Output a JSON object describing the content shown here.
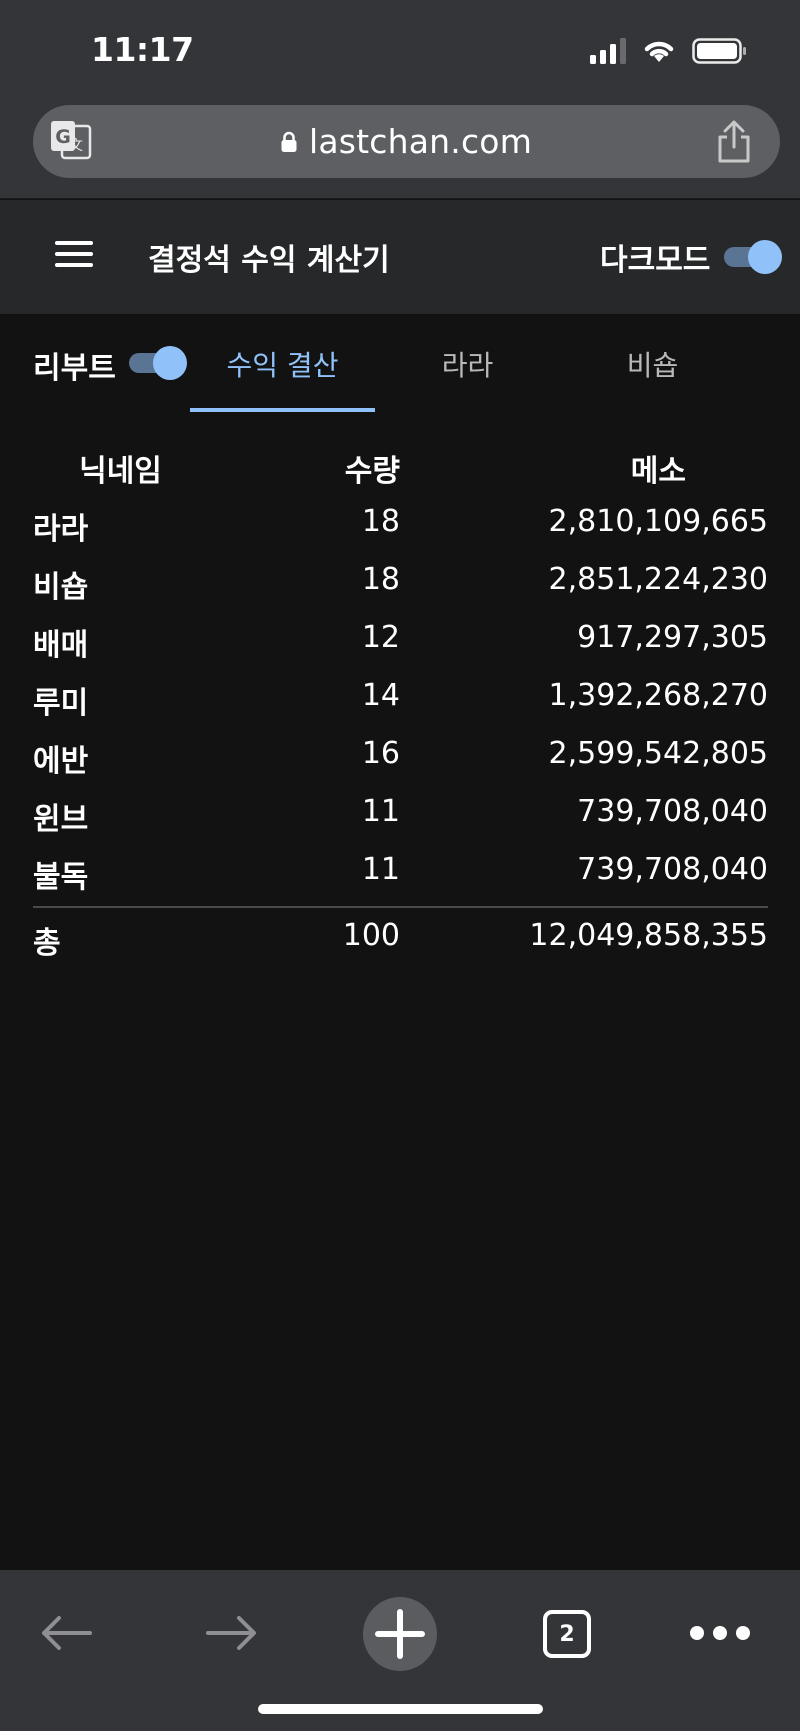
{
  "status_bar": {
    "time": "11:17"
  },
  "browser": {
    "url": "lastchan.com",
    "open_tab_count": "2"
  },
  "header": {
    "title": "결정석 수익 계산기",
    "dark_mode_label": "다크모드",
    "dark_mode_on": true
  },
  "tabs": {
    "rebirth_label": "리부트",
    "rebirth_on": true,
    "items": [
      {
        "label": "수익 결산",
        "active": true
      },
      {
        "label": "라라",
        "active": false
      },
      {
        "label": "비숍",
        "active": false
      }
    ]
  },
  "table": {
    "headers": {
      "name": "닉네임",
      "qty": "수량",
      "meso": "메소"
    },
    "rows": [
      {
        "name": "라라",
        "qty": "18",
        "meso": "2,810,109,665"
      },
      {
        "name": "비숍",
        "qty": "18",
        "meso": "2,851,224,230"
      },
      {
        "name": "배매",
        "qty": "12",
        "meso": "917,297,305"
      },
      {
        "name": "루미",
        "qty": "14",
        "meso": "1,392,268,270"
      },
      {
        "name": "에반",
        "qty": "16",
        "meso": "2,599,542,805"
      },
      {
        "name": "윈브",
        "qty": "11",
        "meso": "739,708,040"
      },
      {
        "name": "불독",
        "qty": "11",
        "meso": "739,708,040"
      }
    ],
    "total": {
      "name": "총",
      "qty": "100",
      "meso": "12,049,858,355"
    }
  },
  "colors": {
    "accent": "#90c2f9",
    "background": "#121212",
    "header_bg": "#27282a",
    "chrome_bg": "#343539"
  }
}
